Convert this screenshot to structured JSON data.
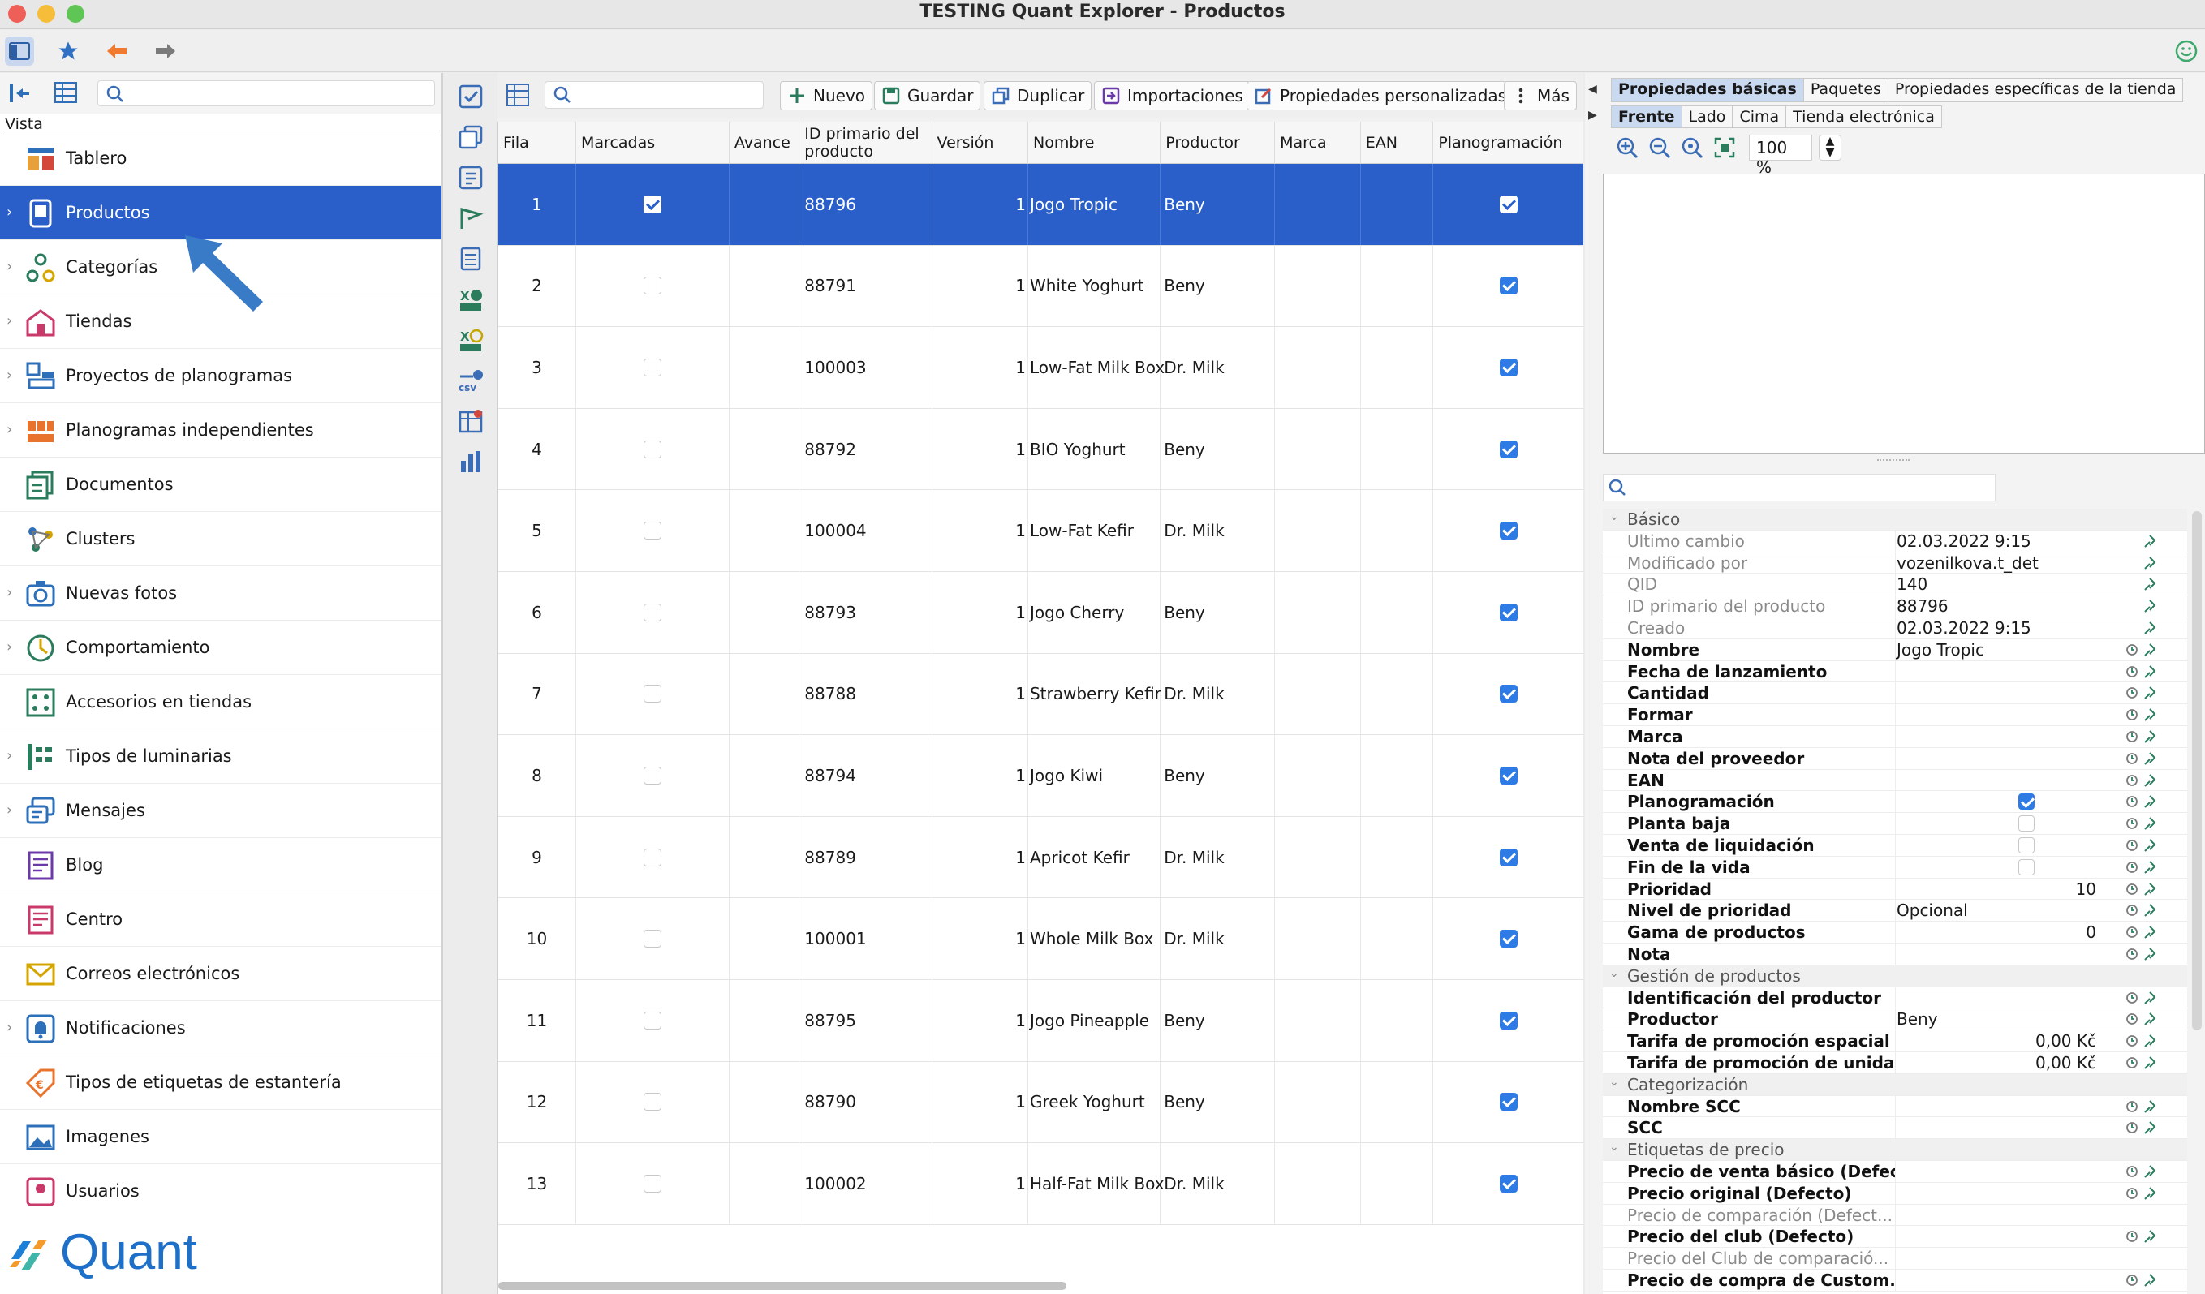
{
  "window": {
    "title": "TESTING Quant Explorer - Productos"
  },
  "sidebar": {
    "vista_label": "Vista",
    "items": [
      {
        "label": "Tablero",
        "icon": "dashboard-icon",
        "chevron": false
      },
      {
        "label": "Productos",
        "icon": "product-icon",
        "chevron": true,
        "selected": true
      },
      {
        "label": "Categorías",
        "icon": "categories-icon",
        "chevron": true
      },
      {
        "label": "Tiendas",
        "icon": "store-icon",
        "chevron": true
      },
      {
        "label": "Proyectos de planogramas",
        "icon": "planogram-projects-icon",
        "chevron": true
      },
      {
        "label": "Planogramas independientes",
        "icon": "planogram-icon",
        "chevron": true
      },
      {
        "label": "Documentos",
        "icon": "documents-icon",
        "chevron": false
      },
      {
        "label": "Clusters",
        "icon": "clusters-icon",
        "chevron": false
      },
      {
        "label": "Nuevas fotos",
        "icon": "camera-icon",
        "chevron": true
      },
      {
        "label": "Comportamiento",
        "icon": "behavior-icon",
        "chevron": true
      },
      {
        "label": "Accesorios en tiendas",
        "icon": "accessories-icon",
        "chevron": false
      },
      {
        "label": "Tipos de luminarias",
        "icon": "luminaires-icon",
        "chevron": true
      },
      {
        "label": "Mensajes",
        "icon": "messages-icon",
        "chevron": true
      },
      {
        "label": "Blog",
        "icon": "blog-icon",
        "chevron": false
      },
      {
        "label": "Centro",
        "icon": "center-icon",
        "chevron": false
      },
      {
        "label": "Correos electrónicos",
        "icon": "email-icon",
        "chevron": false
      },
      {
        "label": "Notificaciones",
        "icon": "bell-icon",
        "chevron": true
      },
      {
        "label": "Tipos de etiquetas de estantería",
        "icon": "price-tag-icon",
        "chevron": false
      },
      {
        "label": "Imagenes",
        "icon": "image-icon",
        "chevron": false
      },
      {
        "label": "Usuarios",
        "icon": "user-icon",
        "chevron": false
      }
    ],
    "logo_text": "Quant"
  },
  "toolbar": {
    "nuevo": "Nuevo",
    "guardar": "Guardar",
    "duplicar": "Duplicar",
    "importaciones": "Importaciones",
    "propiedades": "Propiedades personalizadas",
    "mas": "Más"
  },
  "grid": {
    "columns": [
      "Fila",
      "Marcadas",
      "Avance",
      "ID primario del producto",
      "Versión",
      "Nombre",
      "Productor",
      "Marca",
      "EAN",
      "Planogramación"
    ],
    "rows": [
      {
        "fila": "1",
        "marcada": true,
        "id": "88796",
        "version": "1",
        "nombre": "Jogo Tropic",
        "productor": "Beny",
        "plan": true
      },
      {
        "fila": "2",
        "marcada": false,
        "id": "88791",
        "version": "1",
        "nombre": "White Yoghurt",
        "productor": "Beny",
        "plan": true
      },
      {
        "fila": "3",
        "marcada": false,
        "id": "100003",
        "version": "1",
        "nombre": "Low-Fat Milk Box",
        "productor": "Dr. Milk",
        "plan": true
      },
      {
        "fila": "4",
        "marcada": false,
        "id": "88792",
        "version": "1",
        "nombre": "BIO Yoghurt",
        "productor": "Beny",
        "plan": true
      },
      {
        "fila": "5",
        "marcada": false,
        "id": "100004",
        "version": "1",
        "nombre": "Low-Fat Kefir",
        "productor": "Dr. Milk",
        "plan": true
      },
      {
        "fila": "6",
        "marcada": false,
        "id": "88793",
        "version": "1",
        "nombre": "Jogo Cherry",
        "productor": "Beny",
        "plan": true
      },
      {
        "fila": "7",
        "marcada": false,
        "id": "88788",
        "version": "1",
        "nombre": "Strawberry Kefir",
        "productor": "Dr. Milk",
        "plan": true
      },
      {
        "fila": "8",
        "marcada": false,
        "id": "88794",
        "version": "1",
        "nombre": "Jogo Kiwi",
        "productor": "Beny",
        "plan": true
      },
      {
        "fila": "9",
        "marcada": false,
        "id": "88789",
        "version": "1",
        "nombre": "Apricot Kefir",
        "productor": "Dr. Milk",
        "plan": true
      },
      {
        "fila": "10",
        "marcada": false,
        "id": "100001",
        "version": "1",
        "nombre": "Whole Milk Box",
        "productor": "Dr. Milk",
        "plan": true
      },
      {
        "fila": "11",
        "marcada": false,
        "id": "88795",
        "version": "1",
        "nombre": "Jogo Pineapple",
        "productor": "Beny",
        "plan": true
      },
      {
        "fila": "12",
        "marcada": false,
        "id": "88790",
        "version": "1",
        "nombre": "Greek Yoghurt",
        "productor": "Beny",
        "plan": true
      },
      {
        "fila": "13",
        "marcada": false,
        "id": "100002",
        "version": "1",
        "nombre": "Half-Fat Milk Box",
        "productor": "Dr. Milk",
        "plan": true
      }
    ]
  },
  "right": {
    "tabs": [
      "Propiedades básicas",
      "Paquetes",
      "Propiedades específicas de la tienda"
    ],
    "view_tabs": [
      "Frente",
      "Lado",
      "Cima",
      "Tienda electrónica"
    ],
    "zoom": "100 %",
    "properties": [
      {
        "group": "Básico"
      },
      {
        "key": "Ultimo cambio",
        "value": "02.03.2022 9:15",
        "grey": true
      },
      {
        "key": "Modificado por",
        "value": "vozenilkova.t_det",
        "grey": true
      },
      {
        "key": "QID",
        "value": "140",
        "grey": true
      },
      {
        "key": "ID primario del producto",
        "value": "88796",
        "grey": true
      },
      {
        "key": "Creado",
        "value": "02.03.2022 9:15",
        "grey": true
      },
      {
        "key": "Nombre",
        "value": "Jogo Tropic"
      },
      {
        "key": "Fecha de lanzamiento",
        "value": ""
      },
      {
        "key": "Cantidad",
        "value": ""
      },
      {
        "key": "Formar",
        "value": ""
      },
      {
        "key": "Marca",
        "value": ""
      },
      {
        "key": "Nota del proveedor",
        "value": ""
      },
      {
        "key": "EAN",
        "value": ""
      },
      {
        "key": "Planogramación",
        "check": true
      },
      {
        "key": "Planta baja",
        "check": false
      },
      {
        "key": "Venta de liquidación",
        "check": false
      },
      {
        "key": "Fin de la vida",
        "check": false
      },
      {
        "key": "Prioridad",
        "value": "10",
        "num": true
      },
      {
        "key": "Nivel de prioridad",
        "value": "Opcional"
      },
      {
        "key": "Gama de productos",
        "value": "0",
        "num": true
      },
      {
        "key": "Nota",
        "value": ""
      },
      {
        "group": "Gestión de productos"
      },
      {
        "key": "Identificación del productor",
        "value": ""
      },
      {
        "key": "Productor",
        "value": "Beny"
      },
      {
        "key": "Tarifa de promoción espacial (...",
        "value": "0,00 Kč",
        "num": true
      },
      {
        "key": "Tarifa de promoción de unida...",
        "value": "0,00 Kč",
        "num": true
      },
      {
        "group": "Categorización"
      },
      {
        "key": "Nombre SCC",
        "value": ""
      },
      {
        "key": "SCC",
        "value": ""
      },
      {
        "group": "Etiquetas de precio"
      },
      {
        "key": "Precio de venta básico (Defect...",
        "value": ""
      },
      {
        "key": "Precio original (Defecto)",
        "value": ""
      },
      {
        "key": "Precio de comparación (Defect...",
        "value": "",
        "grey": true
      },
      {
        "key": "Precio del club (Defecto)",
        "value": ""
      },
      {
        "key": "Precio del Club de comparació...",
        "value": "",
        "grey": true
      },
      {
        "key": "Precio de compra de Custom...",
        "value": ""
      }
    ]
  },
  "colors": {
    "selection": "#2a5fc9",
    "check": "#2f7be6",
    "accent_arrow": "#3a7bc8"
  }
}
